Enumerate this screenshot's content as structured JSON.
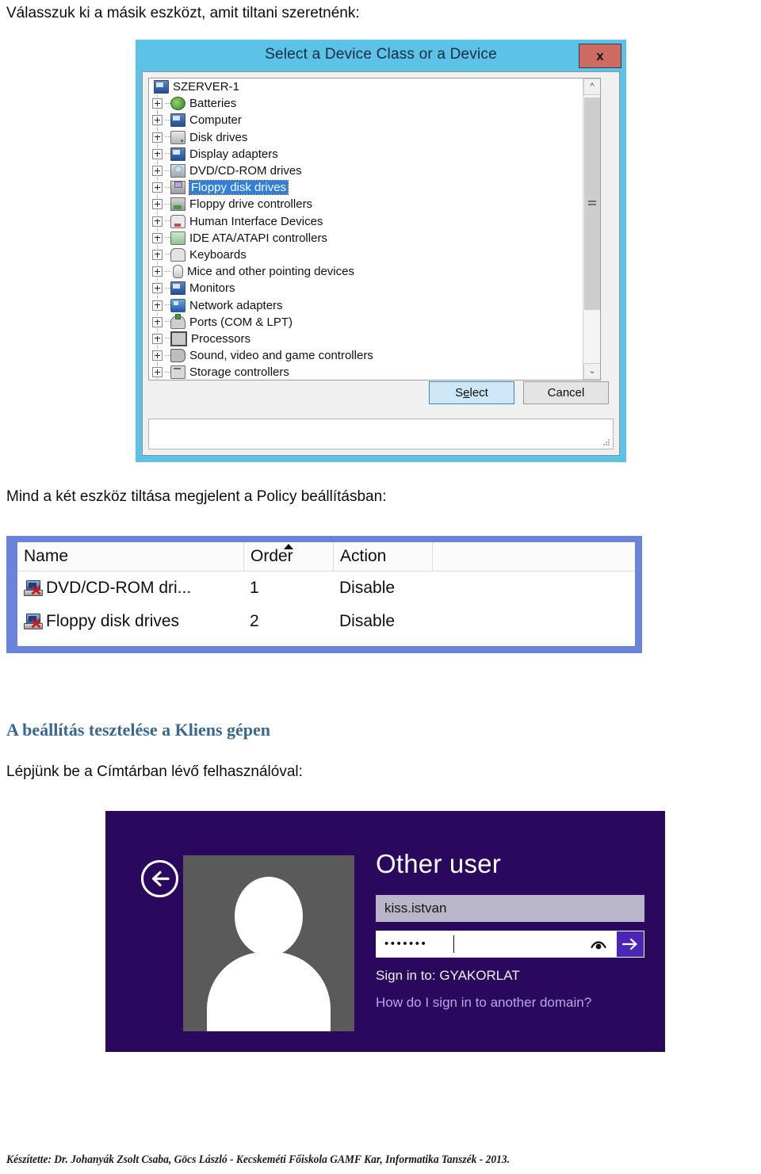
{
  "document": {
    "intro_line": "Válasszuk ki a másik eszközt, amit tiltani szeretnénk:",
    "policy_line": "Mind a két eszköz tiltása megjelent a Policy beállításban:",
    "section_heading": "A beállítás tesztelése a Kliens gépen",
    "login_line": "Lépjünk be a Címtárban lévő felhasználóval:",
    "footer": "Készítette: Dr. Johanyák Zsolt Csaba, Göcs László - Kecskeméti Főiskola GAMF Kar, Informatika Tanszék - 2013."
  },
  "device_dialog": {
    "title": "Select a Device Class or a Device",
    "close_label": "x",
    "root_item": "SZERVER-1",
    "tree_items": [
      {
        "label": "Batteries",
        "icon": "battery-icon",
        "expandable": true,
        "selected": false
      },
      {
        "label": "Computer",
        "icon": "monitor-icon",
        "expandable": true,
        "selected": false
      },
      {
        "label": "Disk drives",
        "icon": "disk-icon",
        "expandable": true,
        "selected": false
      },
      {
        "label": "Display adapters",
        "icon": "display-icon",
        "expandable": true,
        "selected": false
      },
      {
        "label": "DVD/CD-ROM drives",
        "icon": "dvd-icon",
        "expandable": true,
        "selected": false
      },
      {
        "label": "Floppy disk drives",
        "icon": "floppy-icon",
        "expandable": true,
        "selected": true
      },
      {
        "label": "Floppy drive controllers",
        "icon": "fdc-icon",
        "expandable": true,
        "selected": false
      },
      {
        "label": "Human Interface Devices",
        "icon": "hid-icon",
        "expandable": true,
        "selected": false
      },
      {
        "label": "IDE ATA/ATAPI controllers",
        "icon": "ide-icon",
        "expandable": true,
        "selected": false
      },
      {
        "label": "Keyboards",
        "icon": "keyboard-icon",
        "expandable": true,
        "selected": false
      },
      {
        "label": "Mice and other pointing devices",
        "icon": "mouse-icon",
        "expandable": true,
        "selected": false
      },
      {
        "label": "Monitors",
        "icon": "monitor-icon",
        "expandable": true,
        "selected": false
      },
      {
        "label": "Network adapters",
        "icon": "network-icon",
        "expandable": true,
        "selected": false
      },
      {
        "label": "Ports (COM & LPT)",
        "icon": "port-icon",
        "expandable": true,
        "selected": false
      },
      {
        "label": "Processors",
        "icon": "cpu-icon",
        "expandable": true,
        "selected": false
      },
      {
        "label": "Sound, video and game controllers",
        "icon": "sound-icon",
        "expandable": true,
        "selected": false
      },
      {
        "label": "Storage controllers",
        "icon": "storage-icon",
        "expandable": true,
        "selected": false
      }
    ],
    "select_button": "Select",
    "cancel_button": "Cancel",
    "colors": {
      "window_chrome": "#5cc3e7",
      "close_button": "#cd6a62",
      "selection": "#2f7fe0",
      "default_button": "#cfe8f7"
    }
  },
  "policy_table": {
    "columns": [
      "Name",
      "Order",
      "Action"
    ],
    "sorted_column": "Order",
    "rows": [
      {
        "name": "DVD/CD-ROM dri...",
        "order": "1",
        "action": "Disable"
      },
      {
        "name": "Floppy disk drives",
        "order": "2",
        "action": "Disable"
      }
    ],
    "colors": {
      "border": "#6b83d8"
    }
  },
  "login_screen": {
    "title": "Other user",
    "username_value": "kiss.istvan",
    "password_value": "•••••••",
    "sign_in_to": "Sign in to: GYAKORLAT",
    "another_domain_link": "How do I sign in to another domain?",
    "colors": {
      "background": "#29085e",
      "accent": "#4b25b5",
      "link": "#b8a7e6"
    }
  }
}
